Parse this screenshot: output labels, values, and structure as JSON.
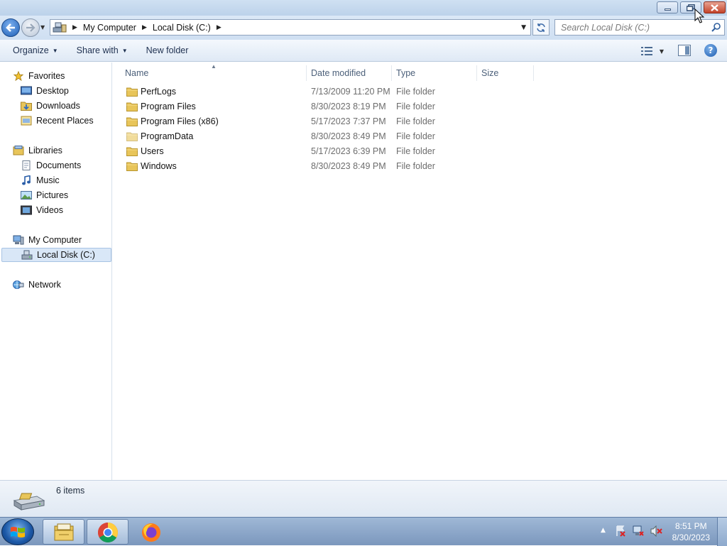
{
  "window": {
    "minimize_icon": "minimize-icon",
    "maximize_icon": "restore-icon",
    "close_icon": "close-icon"
  },
  "nav": {
    "back_icon": "back-arrow-icon",
    "forward_icon": "forward-arrow-icon",
    "breadcrumb": [
      "My Computer",
      "Local Disk (C:)"
    ],
    "search_placeholder": "Search Local Disk (C:)"
  },
  "toolbar": {
    "organize": "Organize",
    "share_with": "Share with",
    "new_folder": "New folder"
  },
  "sidebar": {
    "favorites": "Favorites",
    "desktop": "Desktop",
    "downloads": "Downloads",
    "recent_places": "Recent Places",
    "libraries": "Libraries",
    "documents": "Documents",
    "music": "Music",
    "pictures": "Pictures",
    "videos": "Videos",
    "my_computer": "My Computer",
    "local_disk": "Local Disk (C:)",
    "network": "Network"
  },
  "columns": {
    "name": "Name",
    "date_modified": "Date modified",
    "type": "Type",
    "size": "Size"
  },
  "files": [
    {
      "name": "PerfLogs",
      "date": "7/13/2009 11:20 PM",
      "type": "File folder"
    },
    {
      "name": "Program Files",
      "date": "8/30/2023 8:19 PM",
      "type": "File folder"
    },
    {
      "name": "Program Files (x86)",
      "date": "5/17/2023 7:37 PM",
      "type": "File folder"
    },
    {
      "name": "ProgramData",
      "date": "8/30/2023 8:49 PM",
      "type": "File folder"
    },
    {
      "name": "Users",
      "date": "5/17/2023 6:39 PM",
      "type": "File folder"
    },
    {
      "name": "Windows",
      "date": "8/30/2023 8:49 PM",
      "type": "File folder"
    }
  ],
  "status": {
    "item_count": "6 items"
  },
  "taskbar": {
    "time": "8:51 PM",
    "date": "8/30/2023"
  },
  "colors": {
    "folder": "#e8c55a",
    "selection": "#d9e7f7",
    "accent": "#1f5fb5"
  }
}
